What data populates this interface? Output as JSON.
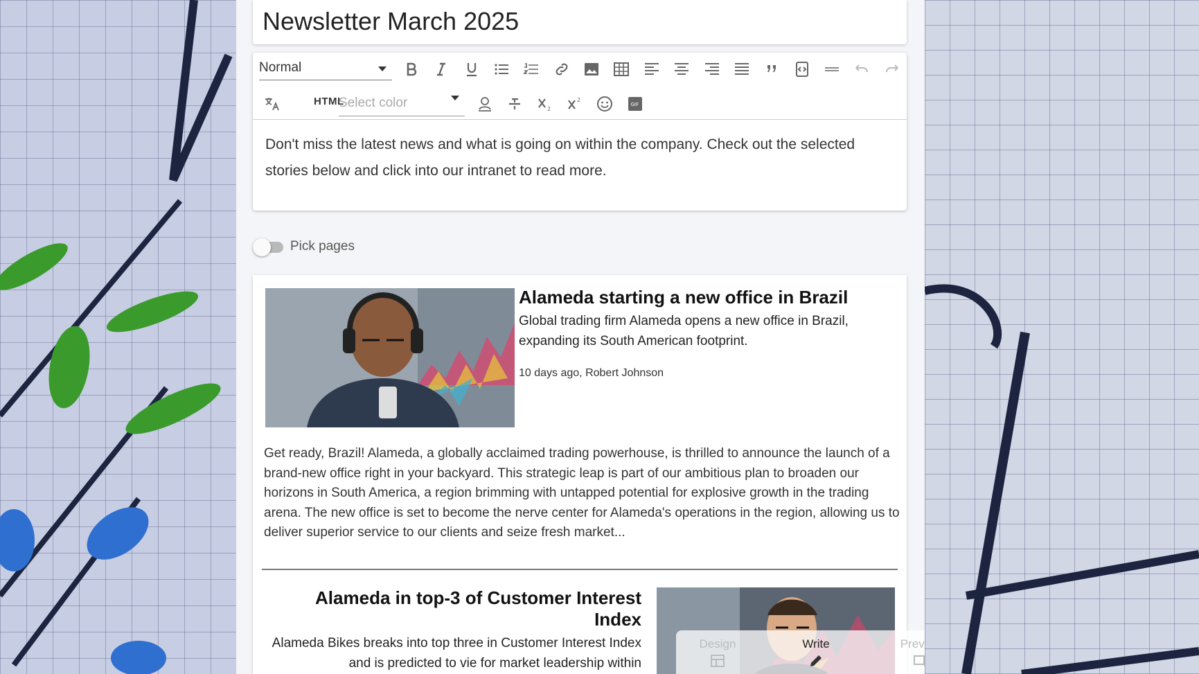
{
  "newsletter": {
    "title": "Newsletter March 2025"
  },
  "toolbar": {
    "paragraph_style": "Normal",
    "html_label": "HTML",
    "color_placeholder": "Select color",
    "icons": [
      "bold-icon",
      "italic-icon",
      "underline-icon",
      "bullet-list-icon",
      "numbered-list-icon",
      "link-icon",
      "image-icon",
      "table-icon",
      "align-left-icon",
      "align-center-icon",
      "align-right-icon",
      "align-justify-icon",
      "quote-icon",
      "code-block-icon",
      "horizontal-rule-icon",
      "undo-icon",
      "redo-icon",
      "translate-icon",
      "personalize-icon",
      "strikethrough-icon",
      "subscript-icon",
      "superscript-icon",
      "emoji-icon",
      "gif-icon"
    ]
  },
  "editor": {
    "body_text": "Don't miss the latest news and what is going on within the company. Check out the selected stories below and click into our intranet to read more."
  },
  "pick_pages": {
    "label": "Pick pages",
    "enabled": false
  },
  "articles": [
    {
      "title": "Alameda starting a new office in Brazil",
      "subtitle": "Global trading firm Alameda opens a new office in Brazil, expanding its South American footprint.",
      "meta": "10 days ago, Robert Johnson",
      "body": "Get ready, Brazil! Alameda, a globally acclaimed trading powerhouse, is thrilled to announce the launch of a brand-new office right in your backyard. This strategic leap is part of our ambitious plan to broaden our horizons in South America, a region brimming with untapped potential for explosive growth in the trading arena. The new office is set to become the nerve center for Alameda's operations in the region, allowing us to deliver superior service to our clients and seize fresh market..."
    },
    {
      "title": "Alameda in top-3 of Customer Interest Index",
      "subtitle": "Alameda Bikes breaks into top three in Customer Interest Index and is predicted to vie for market leadership within"
    }
  ],
  "mode_switcher": {
    "design": "Design",
    "write": "Write",
    "preview": "Preview",
    "active": "Write"
  },
  "colors": {
    "text": "#333333",
    "toolbar_icon": "#666666",
    "page_bg": "#f4f5f8"
  }
}
